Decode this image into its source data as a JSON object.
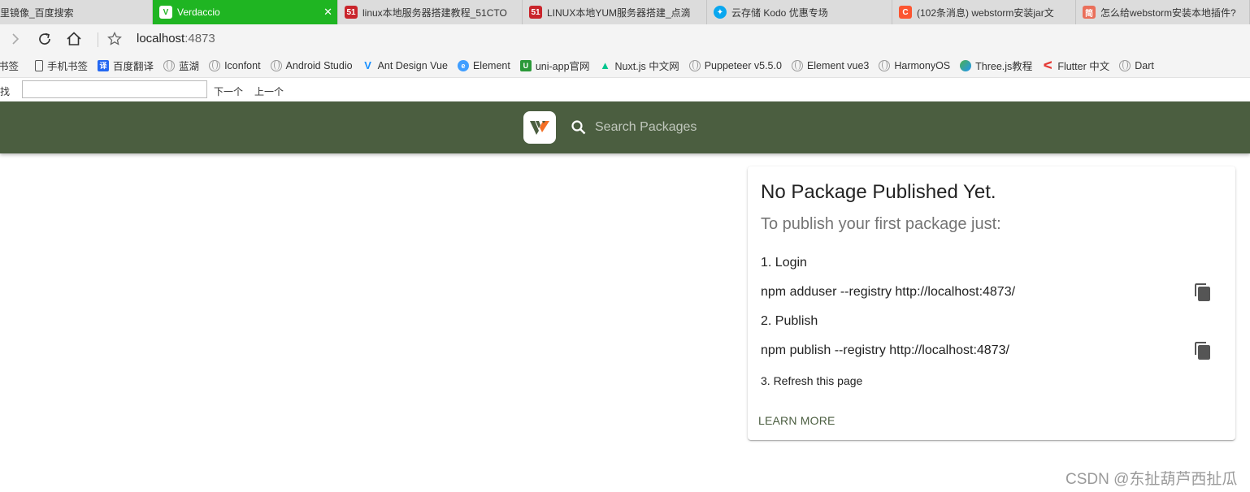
{
  "browser": {
    "tabs": [
      {
        "title": "阿里镜像_百度搜索",
        "icon": "baidu-paw-icon",
        "color": "#dcdcdc",
        "active": false
      },
      {
        "title": "Verdaccio",
        "icon": "verdaccio-favicon",
        "color": "#1fb522",
        "active": true
      },
      {
        "title": "linux本地服务器搭建教程_51CTO",
        "icon": "51cto-icon",
        "color": "#c9242b",
        "active": false
      },
      {
        "title": "LINUX本地YUM服务器搭建_点滴",
        "icon": "51cto-icon",
        "color": "#c9242b",
        "active": false
      },
      {
        "title": "云存储 Kodo 优惠专场",
        "icon": "qiniu-icon",
        "color": "#0aa7ef",
        "active": false
      },
      {
        "title": "(102条消息) webstorm安装jar文",
        "icon": "csdn-icon",
        "color": "#fc5531",
        "active": false
      },
      {
        "title": "怎么给webstorm安装本地插件?",
        "icon": "jianshu-icon",
        "color": "#ea6f5a",
        "active": false
      }
    ],
    "address": {
      "host": "localhost",
      "port": ":4873"
    },
    "bookmarks": [
      {
        "label": "书签",
        "icon": "none"
      },
      {
        "label": "手机书签",
        "icon": "phone-icon"
      },
      {
        "label": "百度翻译",
        "icon": "translate-icon"
      },
      {
        "label": "蓝湖",
        "icon": "globe-icon"
      },
      {
        "label": "Iconfont",
        "icon": "globe-icon"
      },
      {
        "label": "Android Studio",
        "icon": "globe-icon"
      },
      {
        "label": "Ant Design Vue",
        "icon": "antd-icon"
      },
      {
        "label": "Element",
        "icon": "element-icon"
      },
      {
        "label": "uni-app官网",
        "icon": "uniapp-icon"
      },
      {
        "label": "Nuxt.js 中文网",
        "icon": "nuxt-icon"
      },
      {
        "label": "Puppeteer v5.5.0",
        "icon": "globe-icon"
      },
      {
        "label": "Element vue3",
        "icon": "globe-icon"
      },
      {
        "label": "HarmonyOS",
        "icon": "globe-icon"
      },
      {
        "label": "Three.js教程",
        "icon": "threejs-icon"
      },
      {
        "label": "Flutter 中文",
        "icon": "flutter-icon"
      },
      {
        "label": "Dart",
        "icon": "globe-icon"
      }
    ],
    "find": {
      "label": "查找",
      "next": "下一个",
      "prev": "上一个"
    }
  },
  "verdaccio": {
    "search_placeholder": "Search Packages",
    "header_color": "#4b5e40",
    "card": {
      "title": "No Package Published Yet.",
      "subtitle": "To publish your first package just:",
      "step1": "1. Login",
      "cmd1": "npm adduser --registry http://localhost:4873/",
      "step2": "2. Publish",
      "cmd2": "npm publish --registry http://localhost:4873/",
      "step3": "3. Refresh this page",
      "learn_more": "LEARN MORE"
    }
  },
  "watermark": "CSDN @东扯葫芦西扯瓜"
}
